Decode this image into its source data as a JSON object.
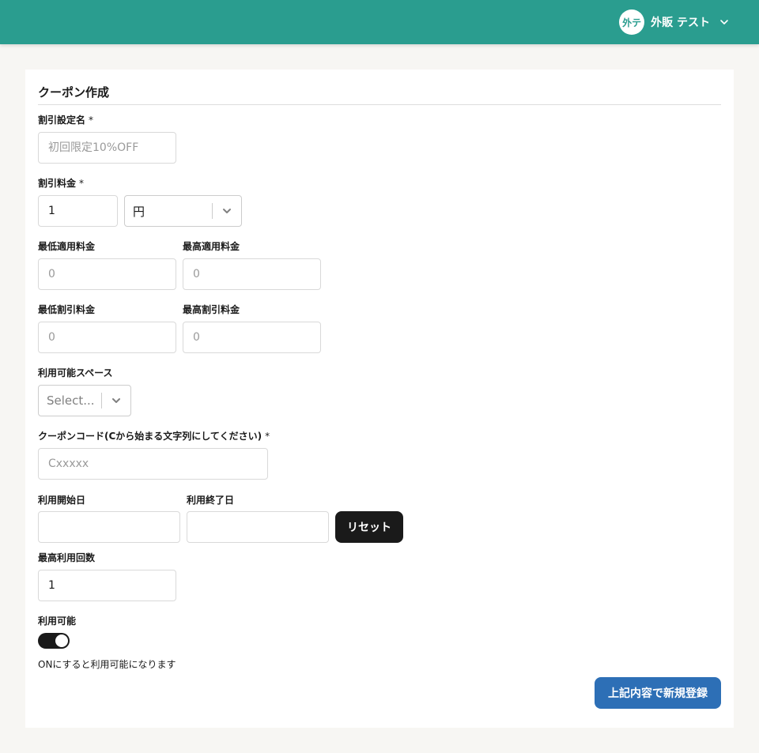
{
  "header": {
    "avatar_text": "外テ",
    "user_name": "外販 テスト",
    "color": "#2a9d8f"
  },
  "form": {
    "title": "クーポン作成",
    "discount_name": {
      "label": "割引設定名",
      "required_mark": "*",
      "value": "",
      "placeholder": "初回限定10%OFF"
    },
    "discount_amount": {
      "label": "割引料金",
      "required_mark": "*",
      "value": "1",
      "unit_selected": "円"
    },
    "min_applicable": {
      "label": "最低適用料金",
      "value": "",
      "placeholder": "0"
    },
    "max_applicable": {
      "label": "最高適用料金",
      "value": "",
      "placeholder": "0"
    },
    "min_discount": {
      "label": "最低割引料金",
      "value": "",
      "placeholder": "0"
    },
    "max_discount": {
      "label": "最高割引料金",
      "value": "",
      "placeholder": "0"
    },
    "spaces": {
      "label": "利用可能スペース",
      "placeholder": "Select..."
    },
    "coupon_code": {
      "label": "クーポンコード(Cから始まる文字列にしてください)",
      "required_mark": "*",
      "value": "",
      "placeholder": "Cxxxxx"
    },
    "start_date": {
      "label": "利用開始日",
      "value": ""
    },
    "end_date": {
      "label": "利用終了日",
      "value": ""
    },
    "reset_label": "リセット",
    "max_uses": {
      "label": "最高利用回数",
      "value": "1"
    },
    "available": {
      "label": "利用可能",
      "on": true,
      "hint": "ONにすると利用可能になります"
    },
    "submit_label": "上記内容で新規登録",
    "submit_color": "#2d6fb6"
  }
}
